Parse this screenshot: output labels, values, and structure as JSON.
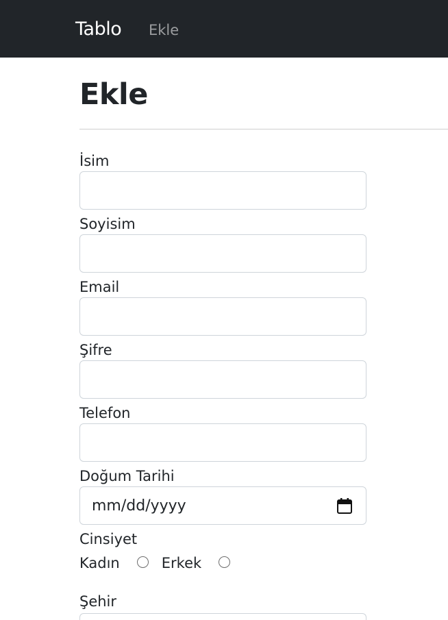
{
  "navbar": {
    "brand": "Tablo",
    "link": "Ekle"
  },
  "page": {
    "title": "Ekle"
  },
  "form": {
    "first_name_label": "İsim",
    "last_name_label": "Soyisim",
    "email_label": "Email",
    "password_label": "Şifre",
    "phone_label": "Telefon",
    "birthdate_label": "Doğum Tarihi",
    "birthdate_placeholder": "mm/dd/yyyy",
    "gender_label": "Cinsiyet",
    "gender_options": [
      "Kadın",
      "Erkek"
    ],
    "city_label": "Şehir"
  },
  "icons": {
    "calendar": "calendar-icon"
  }
}
